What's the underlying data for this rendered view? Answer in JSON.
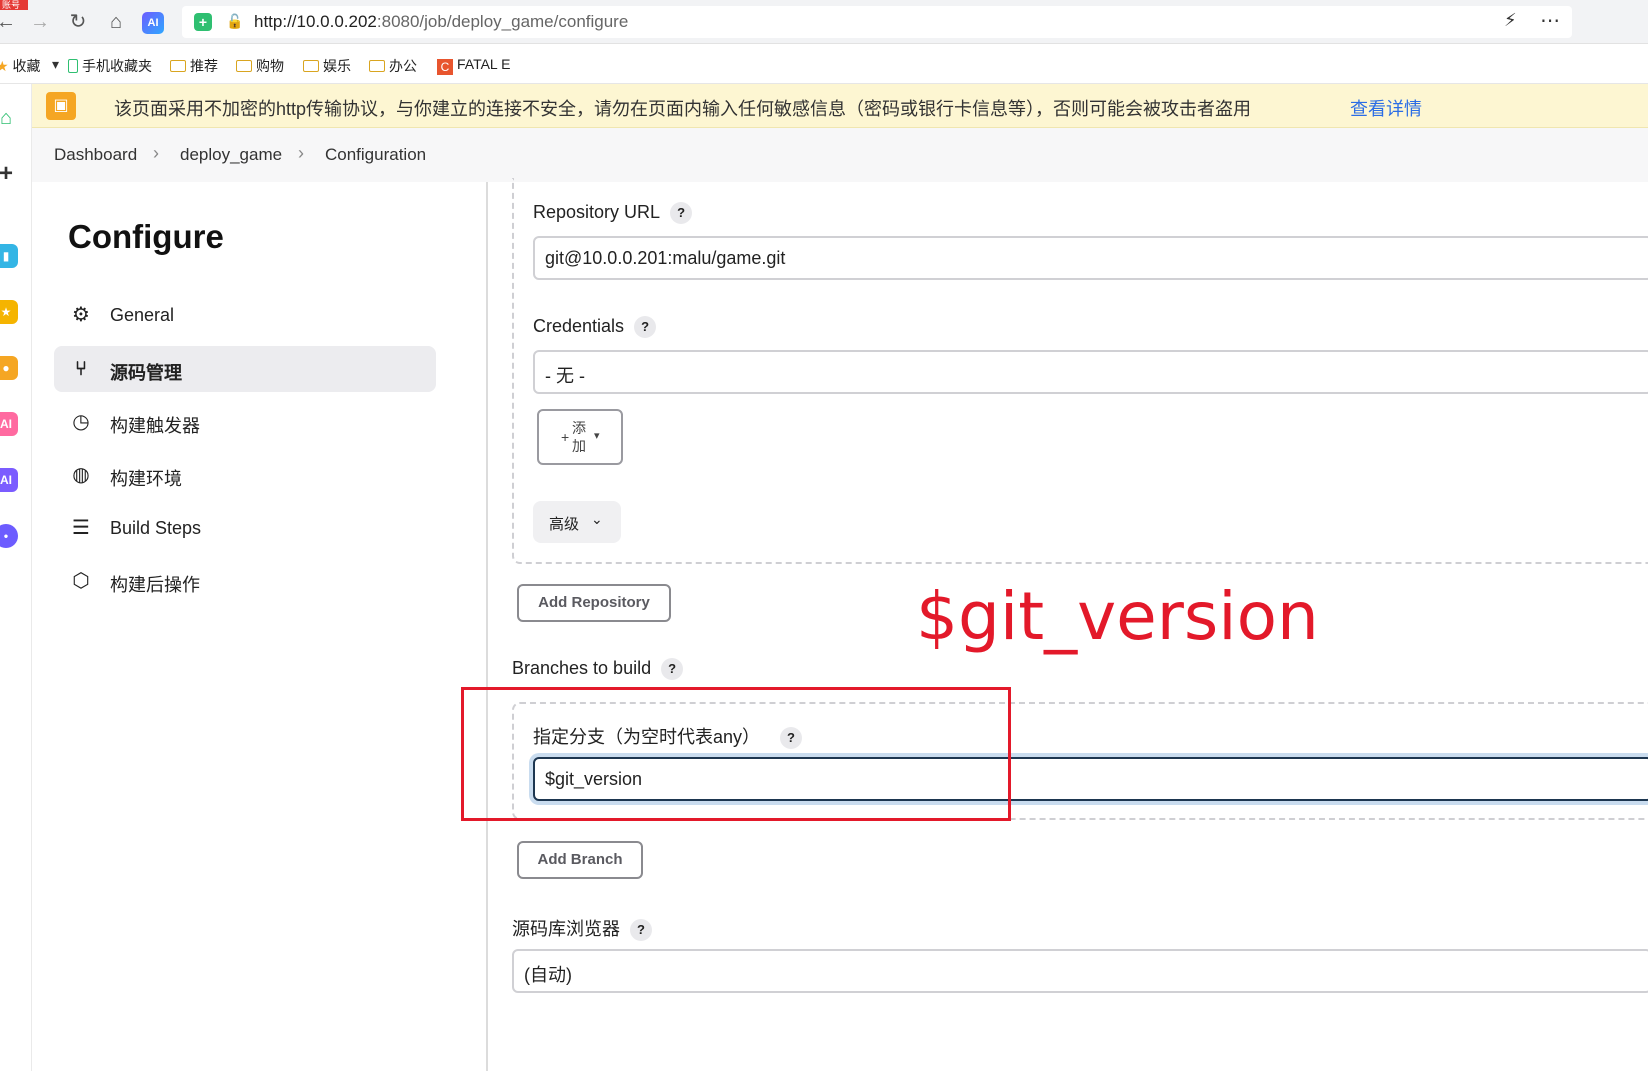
{
  "browser": {
    "badge": "账号",
    "url_host": "http://10.0.0.202",
    "url_rest": ":8080/job/deploy_game/configure",
    "ai_label": "AI"
  },
  "bookmarks": {
    "favorites": "收藏",
    "items": [
      "手机收藏夹",
      "推荐",
      "购物",
      "娱乐",
      "办公"
    ],
    "fatal": "FATAL E",
    "fatal_icon_letter": "C"
  },
  "warning": {
    "text": "该页面采用不加密的http传输协议，与你建立的连接不安全，请勿在页面内输入任何敏感信息（密码或银行卡信息等），否则可能会被攻击者盗用",
    "link": "查看详情"
  },
  "breadcrumb": {
    "items": [
      "Dashboard",
      "deploy_game",
      "Configuration"
    ]
  },
  "sidebar": {
    "title": "Configure",
    "items": [
      {
        "label": "General",
        "icon": "gear-icon"
      },
      {
        "label": "源码管理",
        "icon": "branch-icon"
      },
      {
        "label": "构建触发器",
        "icon": "clock-icon"
      },
      {
        "label": "构建环境",
        "icon": "globe-icon"
      },
      {
        "label": "Build Steps",
        "icon": "list-icon"
      },
      {
        "label": "构建后操作",
        "icon": "package-icon"
      }
    ]
  },
  "scm": {
    "repo_url_label": "Repository URL",
    "repo_url_value": "git@10.0.0.201:malu/game.git",
    "credentials_label": "Credentials",
    "credentials_value": "- 无 -",
    "add_button_line1": "添",
    "add_button_line2": "加",
    "advanced_label": "高级",
    "add_repository": "Add Repository",
    "branches_label": "Branches to build",
    "branch_spec_label": "指定分支（为空时代表any）",
    "branch_spec_value": "$git_version",
    "add_branch": "Add Branch",
    "browser_label": "源码库浏览器",
    "browser_value": "(自动)",
    "help_mark": "?"
  },
  "annotation": {
    "text": "$git_version",
    "color": "#e3192a"
  }
}
